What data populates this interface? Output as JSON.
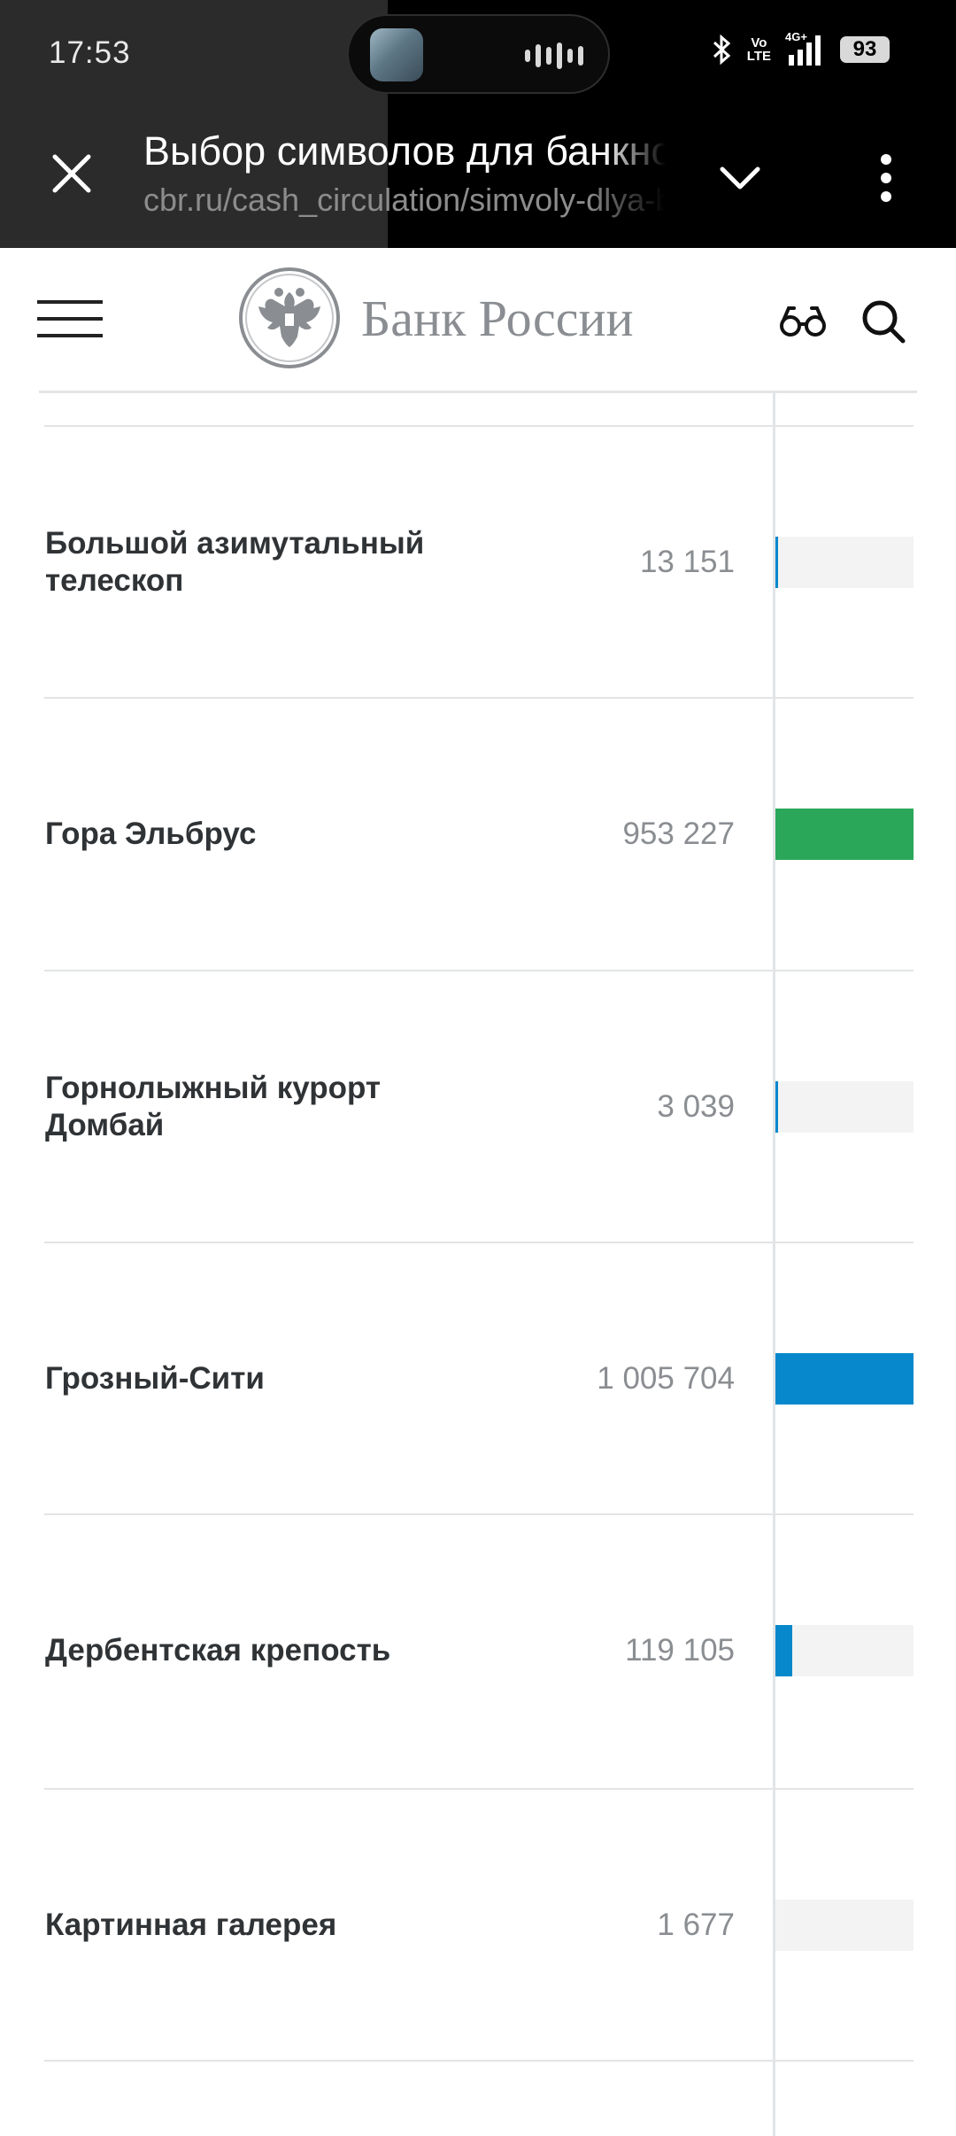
{
  "status_bar": {
    "time": "17:53",
    "battery": "93",
    "volte_top": "Vo",
    "volte_bottom": "LTE",
    "network": "4G+"
  },
  "tab_bar": {
    "title": "Выбор символов для банкнот",
    "url": "cbr.ru/cash_circulation/simvoly-dlya-banknot/"
  },
  "site": {
    "logo_text": "Банк России"
  },
  "colors": {
    "bar_blue": "#0788cc",
    "bar_green": "#2ba75a",
    "bar_track": "#f3f3f3"
  },
  "rows": [
    {
      "name": "Большой азимутальный телескоп",
      "count": "13 151",
      "bar_color": "blue",
      "bar_fraction": 0.013
    },
    {
      "name": "Гора Эльбрус",
      "count": "953 227",
      "bar_color": "green",
      "bar_fraction": 1.0
    },
    {
      "name": "Горнолыжный курорт Домбай",
      "count": "3 039",
      "bar_color": "blue",
      "bar_fraction": 0.003
    },
    {
      "name": "Грозный-Сити",
      "count": "1 005 704",
      "bar_color": "blue",
      "bar_fraction": 1.0
    },
    {
      "name": "Дербентская крепость",
      "count": "119 105",
      "bar_color": "blue",
      "bar_fraction": 0.12
    },
    {
      "name": "Картинная галерея",
      "count": "1 677",
      "bar_color": "blue",
      "bar_fraction": 0.002
    }
  ]
}
